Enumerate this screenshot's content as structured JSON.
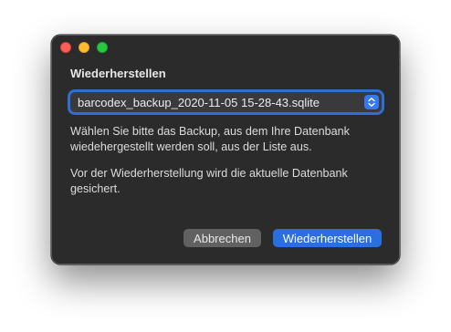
{
  "window": {
    "title": "Wiederherstellen"
  },
  "backup_select": {
    "value": "barcodex_backup_2020-11-05 15-28-43.sqlite",
    "icon": "chevron-up-down-icon"
  },
  "message": {
    "line1": "Wählen Sie bitte das Backup, aus dem Ihre Datenbank wiedehergestellt werden soll, aus der Liste aus.",
    "line2": "Vor der Wiederherstellung wird die aktuelle Datenbank gesichert."
  },
  "buttons": {
    "cancel_label": "Abbrechen",
    "restore_label": "Wiederherstellen"
  },
  "colors": {
    "accent": "#2a6fe0",
    "window_bg": "#2b2b2b",
    "close": "#ff5f57",
    "minimize": "#febc2e",
    "zoom": "#28c840"
  }
}
